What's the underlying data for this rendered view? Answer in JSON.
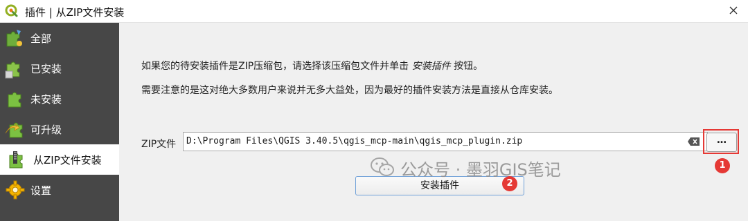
{
  "window": {
    "title": "插件 | 从ZIP文件安装",
    "icon": "qgis-logo-icon"
  },
  "sidebar": {
    "items": [
      {
        "label": "全部",
        "icon": "puzzle-all-icon"
      },
      {
        "label": "已安装",
        "icon": "puzzle-installed-icon"
      },
      {
        "label": "未安装",
        "icon": "puzzle-not-installed-icon"
      },
      {
        "label": "可升级",
        "icon": "puzzle-upgradeable-icon"
      },
      {
        "label": "从ZIP文件安装",
        "icon": "zip-install-icon",
        "active": true
      },
      {
        "label": "设置",
        "icon": "settings-gear-icon"
      }
    ]
  },
  "main": {
    "info_line1_pre": "如果您的待安装插件是ZIP压缩包，请选择该压缩包文件并单击 ",
    "info_line1_em": "安装插件",
    "info_line1_post": " 按钮。",
    "info_line2": "需要注意的是这对绝大多数用户来说并无多大益处，因为最好的插件安装方法是直接从仓库安装。",
    "zip_label": "ZIP文件",
    "zip_path": "D:\\Program Files\\QGIS 3.40.5\\qgis_mcp-main\\qgis_mcp_plugin.zip",
    "browse_label": "…",
    "install_label": "安装插件"
  },
  "annotations": {
    "badge1": "1",
    "badge2": "2"
  },
  "watermark": {
    "text": "公众号 · 墨羽GIS笔记"
  },
  "colors": {
    "sidebar_bg": "#474747",
    "highlight": "#e53935",
    "install_border": "#6fa0d8"
  }
}
